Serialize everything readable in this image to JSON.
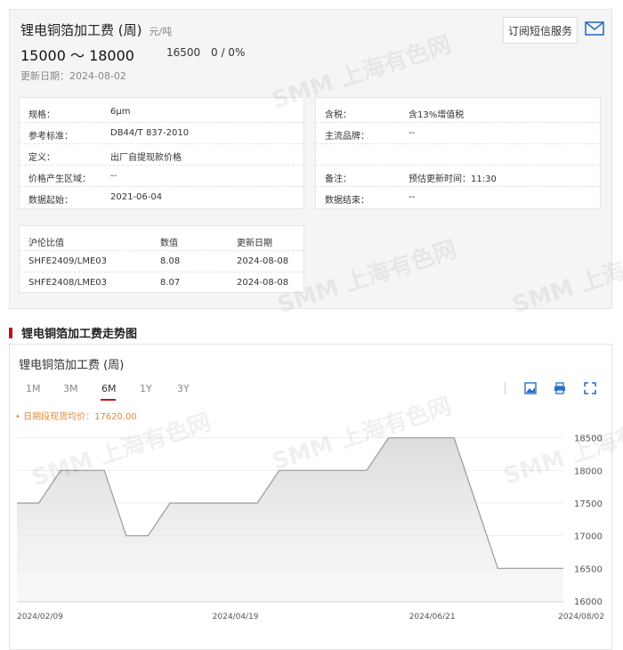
{
  "header": {
    "title": "锂电铜箔加工费 (周)",
    "unit": "元/吨",
    "range": "15000 ～ 18000",
    "mid_price": "16500",
    "change": "0 / 0%",
    "updated": "更新日期：2024-08-02",
    "subscribe_label": "订阅短信服务"
  },
  "info_left": [
    {
      "label": "规格：",
      "value": "6μm"
    },
    {
      "label": "参考标准：",
      "value": "DB44/T 837-2010"
    },
    {
      "label": "定义：",
      "value": "出厂自提现款价格"
    },
    {
      "label": "价格产生区域：",
      "value": "--"
    },
    {
      "label": "数据起始：",
      "value": "2021-06-04"
    }
  ],
  "info_right": [
    {
      "label": "含税：",
      "value": "含13%增值税"
    },
    {
      "label": "主流品牌：",
      "value": "--"
    },
    {
      "label": "",
      "value": ""
    },
    {
      "label": "备注：",
      "value": "预估更新时间：11:30"
    },
    {
      "label": "数据结束：",
      "value": "--"
    }
  ],
  "ratio_table": {
    "headers": [
      "沪伦比值",
      "数值",
      "更新日期"
    ],
    "rows": [
      [
        "SHFE2409/LME03",
        "8.08",
        "2024-08-08"
      ],
      [
        "SHFE2408/LME03",
        "8.07",
        "2024-08-08"
      ]
    ]
  },
  "section_title": "锂电铜箔加工费走势图",
  "chart_panel": {
    "title": "锂电铜箔加工费 (周)",
    "tabs": [
      "1M",
      "3M",
      "6M",
      "1Y",
      "3Y"
    ],
    "active_tab": "6M",
    "average_label": "• 日期段现货均价：17620.00",
    "icons": [
      "image-download-icon",
      "print-icon",
      "fullscreen-icon"
    ]
  },
  "watermark": "SMM 上海有色网",
  "colors": {
    "accent": "#c4121b",
    "line": "#9a9a9a",
    "area": "#e6e6e6",
    "avg": "#e08a3a"
  },
  "chart_data": {
    "type": "area",
    "x": [
      "2024-02-09",
      "2024-02-16",
      "2024-02-23",
      "2024-03-01",
      "2024-03-08",
      "2024-03-15",
      "2024-03-22",
      "2024-03-29",
      "2024-04-05",
      "2024-04-12",
      "2024-04-19",
      "2024-04-26",
      "2024-05-03",
      "2024-05-10",
      "2024-05-17",
      "2024-05-24",
      "2024-05-31",
      "2024-06-07",
      "2024-06-14",
      "2024-06-21",
      "2024-06-28",
      "2024-07-05",
      "2024-07-12",
      "2024-07-19",
      "2024-07-26",
      "2024-08-02"
    ],
    "values": [
      17500,
      17500,
      18000,
      18000,
      18000,
      17000,
      17000,
      17500,
      17500,
      17500,
      17500,
      17500,
      18000,
      18000,
      18000,
      18000,
      18000,
      18500,
      18500,
      18500,
      18500,
      17500,
      16500,
      16500,
      16500,
      16500
    ],
    "x_tick_labels": [
      "2024/02/09",
      "2024/04/19",
      "2024/06/21",
      "2024/08/02"
    ],
    "y_ticks": [
      16000,
      16500,
      17000,
      17500,
      18000,
      18500
    ],
    "ylim": [
      16000,
      18700
    ],
    "grid": true
  }
}
